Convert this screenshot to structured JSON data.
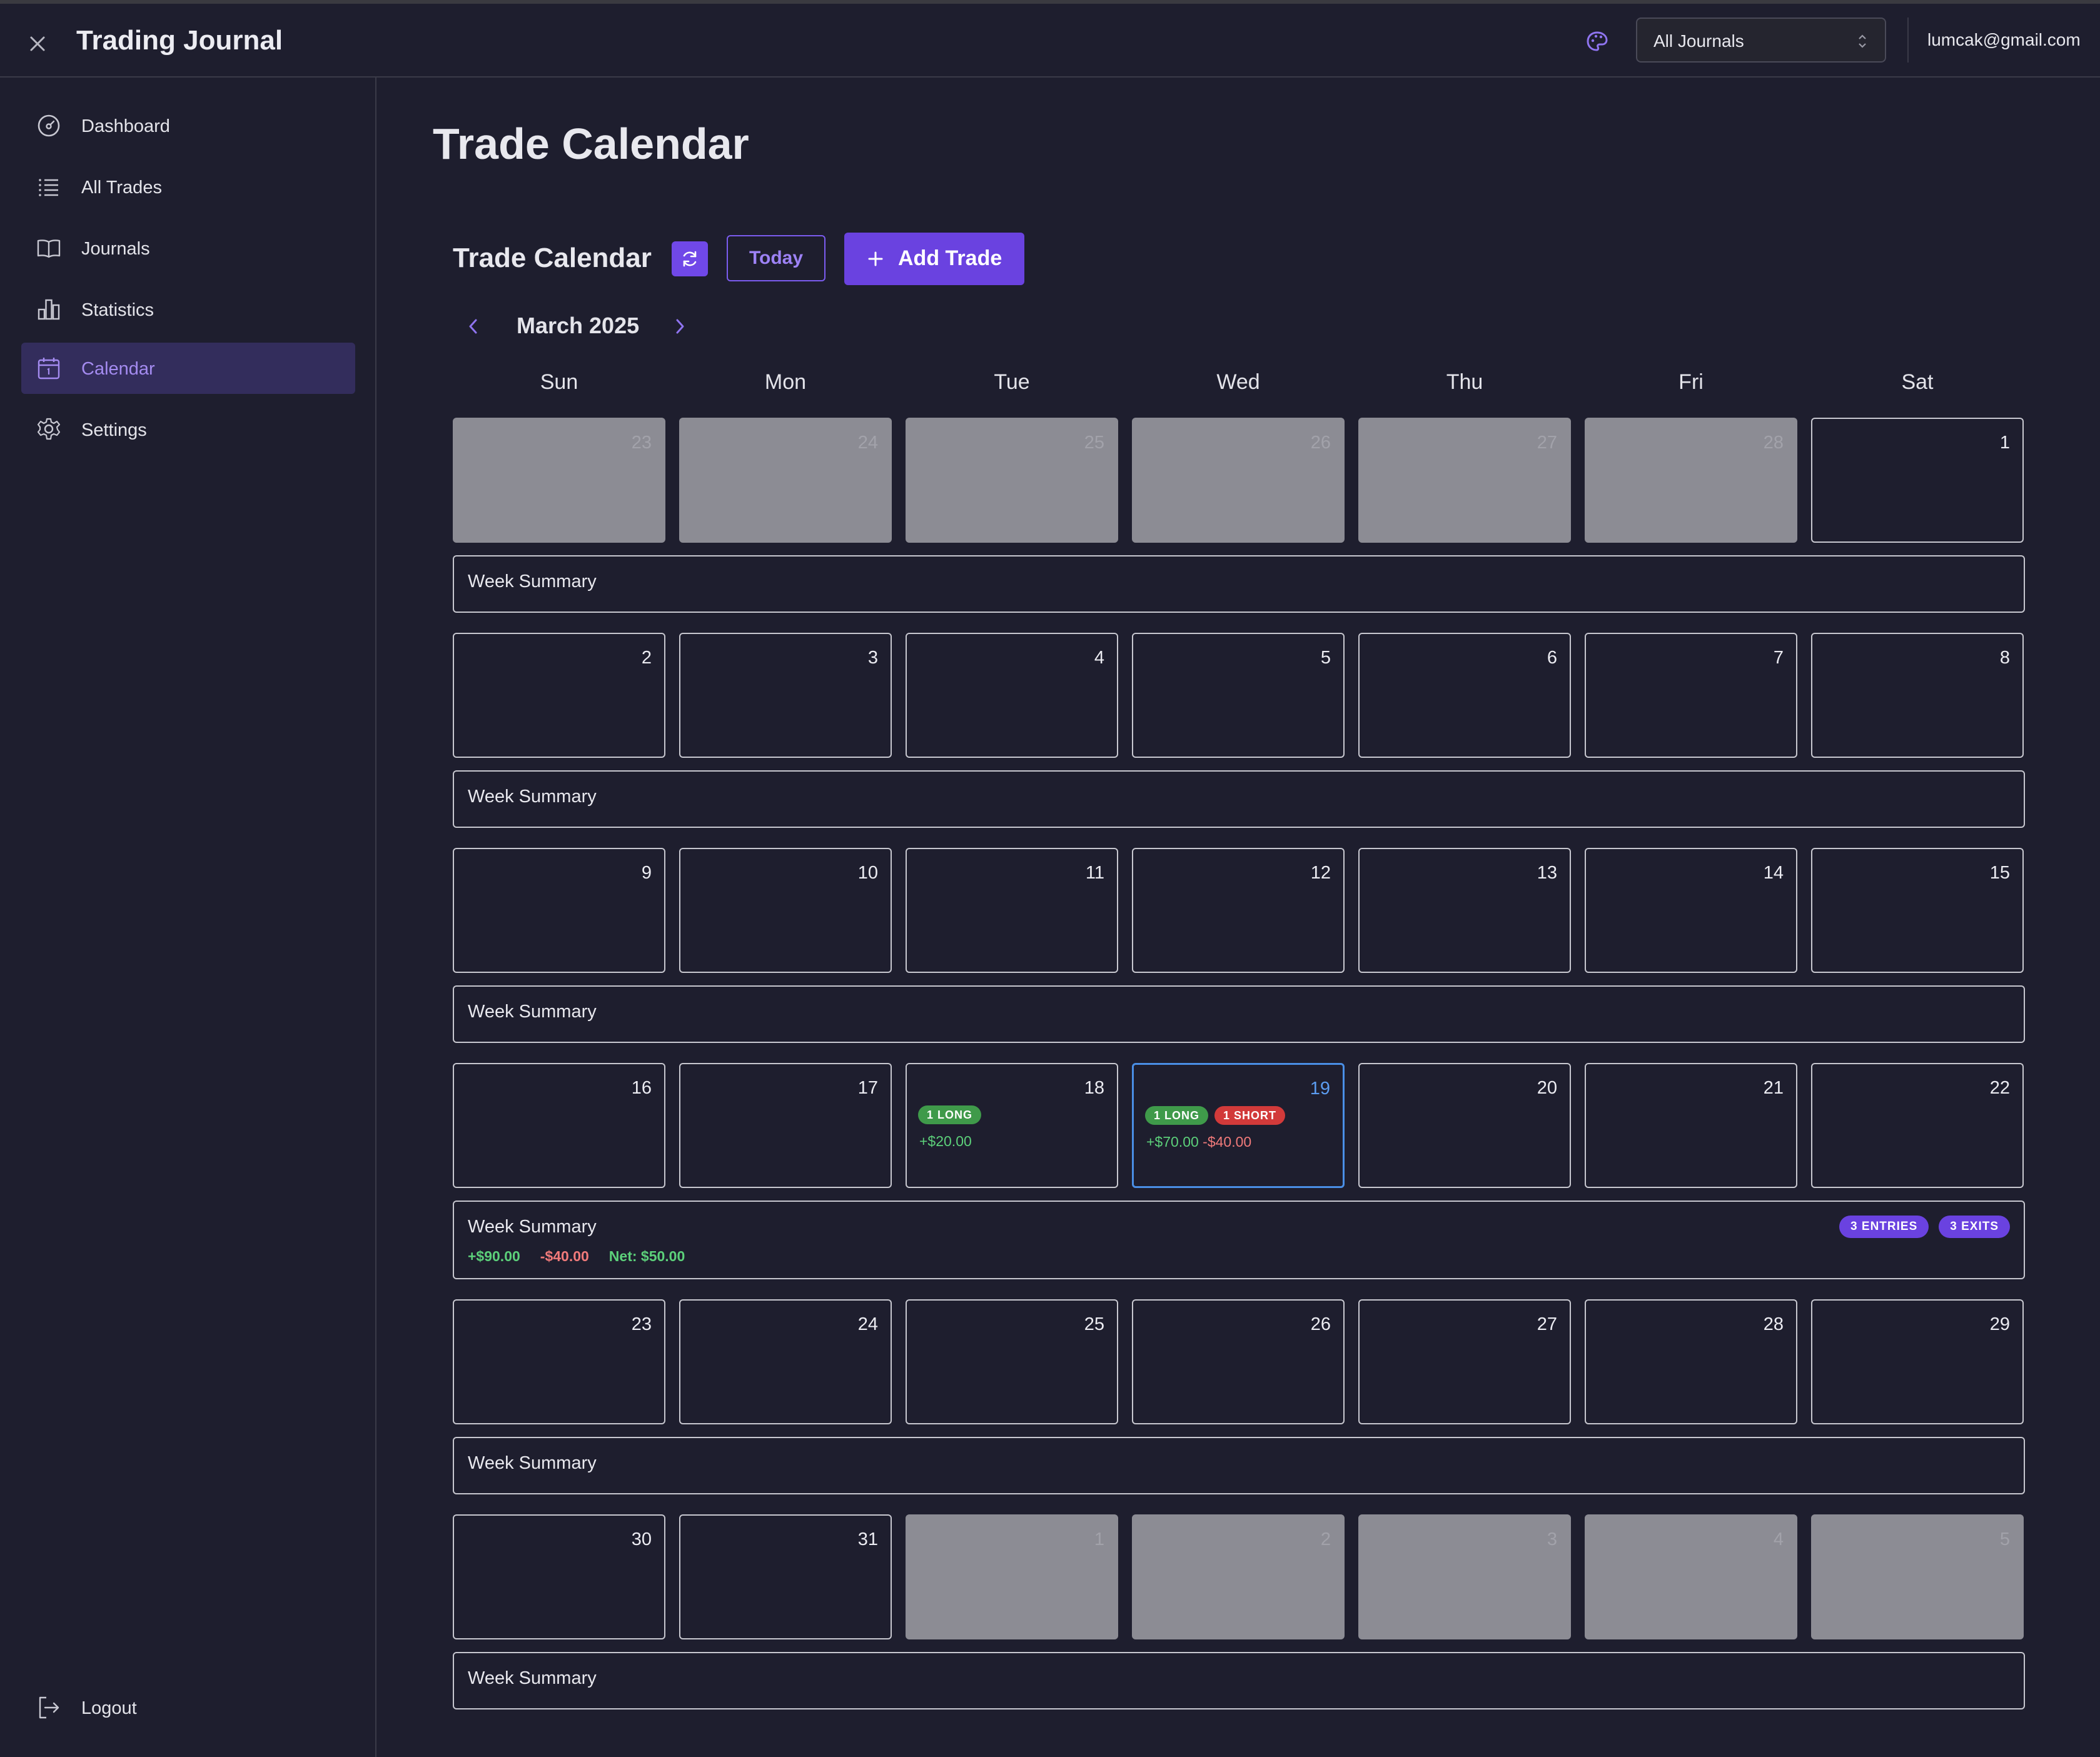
{
  "header": {
    "app_title": "Trading Journal",
    "journal_select": "All Journals",
    "user_email": "lumcak@gmail.com"
  },
  "sidebar": {
    "items": [
      {
        "label": "Dashboard",
        "icon": "gauge-icon"
      },
      {
        "label": "All Trades",
        "icon": "list-icon"
      },
      {
        "label": "Journals",
        "icon": "book-icon"
      },
      {
        "label": "Statistics",
        "icon": "bar-chart-icon"
      },
      {
        "label": "Calendar",
        "icon": "calendar-icon",
        "active": true
      },
      {
        "label": "Settings",
        "icon": "gear-icon"
      }
    ],
    "logout": "Logout"
  },
  "main": {
    "page_title": "Trade Calendar",
    "calendar_title": "Trade Calendar",
    "today_label": "Today",
    "add_trade_label": "Add Trade",
    "month_label": "March 2025",
    "weekdays": [
      "Sun",
      "Mon",
      "Tue",
      "Wed",
      "Thu",
      "Fri",
      "Sat"
    ]
  },
  "calendar": {
    "weeks": [
      {
        "days": [
          {
            "day": "23",
            "other": true
          },
          {
            "day": "24",
            "other": true
          },
          {
            "day": "25",
            "other": true
          },
          {
            "day": "26",
            "other": true
          },
          {
            "day": "27",
            "other": true
          },
          {
            "day": "28",
            "other": true
          },
          {
            "day": "1"
          }
        ],
        "summary": {
          "label": "Week Summary"
        }
      },
      {
        "days": [
          {
            "day": "2"
          },
          {
            "day": "3"
          },
          {
            "day": "4"
          },
          {
            "day": "5"
          },
          {
            "day": "6"
          },
          {
            "day": "7"
          },
          {
            "day": "8"
          }
        ],
        "summary": {
          "label": "Week Summary"
        }
      },
      {
        "days": [
          {
            "day": "9"
          },
          {
            "day": "10"
          },
          {
            "day": "11"
          },
          {
            "day": "12"
          },
          {
            "day": "13"
          },
          {
            "day": "14"
          },
          {
            "day": "15"
          }
        ],
        "summary": {
          "label": "Week Summary"
        }
      },
      {
        "days": [
          {
            "day": "16"
          },
          {
            "day": "17"
          },
          {
            "day": "18",
            "badges": [
              {
                "text": "1 LONG",
                "type": "long"
              }
            ],
            "pnl": [
              {
                "text": "+$20.00",
                "type": "pos"
              }
            ]
          },
          {
            "day": "19",
            "today": true,
            "badges": [
              {
                "text": "1 LONG",
                "type": "long"
              },
              {
                "text": "1 SHORT",
                "type": "short"
              }
            ],
            "pnl": [
              {
                "text": "+$70.00",
                "type": "pos"
              },
              {
                "text": "-$40.00",
                "type": "neg"
              }
            ]
          },
          {
            "day": "20"
          },
          {
            "day": "21"
          },
          {
            "day": "22"
          }
        ],
        "summary": {
          "label": "Week Summary",
          "profit": "+$90.00",
          "loss": "-$40.00",
          "net": "Net: $50.00",
          "entries": "3 ENTRIES",
          "exits": "3 EXITS"
        }
      },
      {
        "days": [
          {
            "day": "23"
          },
          {
            "day": "24"
          },
          {
            "day": "25"
          },
          {
            "day": "26"
          },
          {
            "day": "27"
          },
          {
            "day": "28"
          },
          {
            "day": "29"
          }
        ],
        "summary": {
          "label": "Week Summary"
        }
      },
      {
        "days": [
          {
            "day": "30"
          },
          {
            "day": "31"
          },
          {
            "day": "1",
            "other": true
          },
          {
            "day": "2",
            "other": true
          },
          {
            "day": "3",
            "other": true
          },
          {
            "day": "4",
            "other": true
          },
          {
            "day": "5",
            "other": true
          }
        ],
        "summary": {
          "label": "Week Summary"
        }
      }
    ]
  },
  "colors": {
    "background": "#1e1e2e",
    "accent": "#6a42e0",
    "today_border": "#4a8fe6",
    "profit": "#5cd07a",
    "loss": "#f07a7a"
  }
}
